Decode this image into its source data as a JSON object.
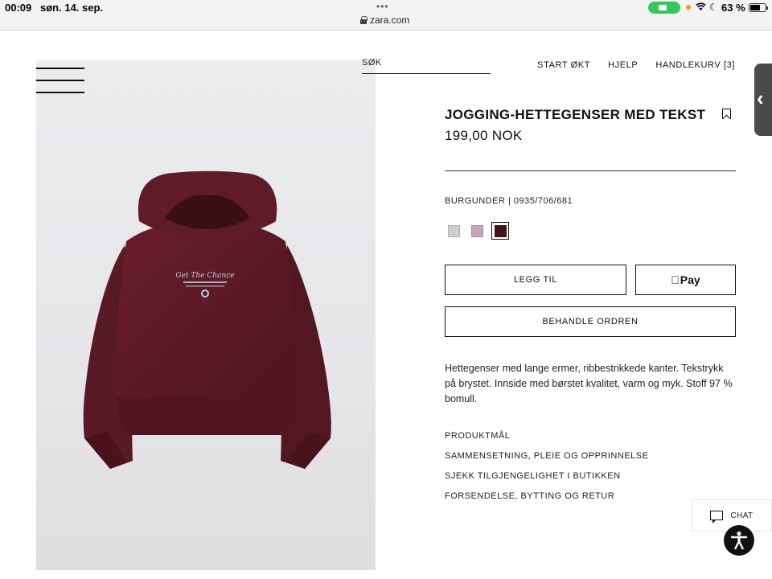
{
  "status_bar": {
    "time": "00:09",
    "date": "søn. 14. sep.",
    "url": "zara.com",
    "battery": "63 %"
  },
  "header": {
    "search_label": "SØK",
    "nav": {
      "start": "START ØKT",
      "help": "HJELP",
      "cart": "HANDLEKURV [3]"
    }
  },
  "product": {
    "title": "JOGGING-HETTEGENSER MED TEKST",
    "price": "199,00 NOK",
    "color_ref": "BURGUNDER | 0935/706/681",
    "swatches": [
      {
        "color": "#cfcfcf"
      },
      {
        "color": "#c9a2c4"
      },
      {
        "color": "#43141c",
        "selected": true
      }
    ],
    "add_button": "LEGG TIL",
    "apple_pay": "Pay",
    "order_button": "BEHANDLE ORDREN",
    "description": "Hettegenser med lange ermer, ribbestrikkede kanter. Tekstrykk på brystet. Innside med børstet kvalitet, varm og myk. Stoff 97 % bomull.",
    "links": {
      "measurements": "PRODUKTMÅL",
      "composition": "SAMMENSETNING, PLEIE OG OPPRINNELSE",
      "availability": "SJEKK TILGJENGELIGHET I BUTIKKEN",
      "shipping": "FORSENDELSE, BYTTING OG RETUR"
    },
    "print_text": "Get The Chance"
  },
  "chat": {
    "label": "CHAT"
  },
  "colors": {
    "hoodie": "#5e1a24",
    "accent_dark": "#111111"
  }
}
